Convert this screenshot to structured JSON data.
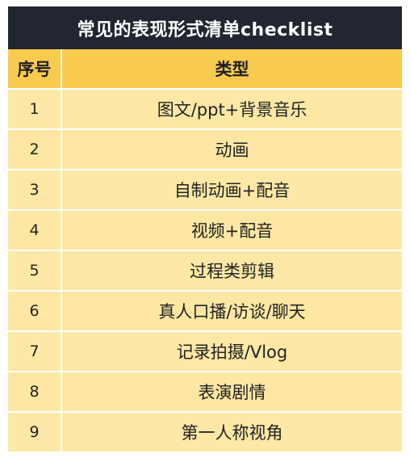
{
  "title": "常见的表现形式清单checklist",
  "header": {
    "index_label": "序号",
    "type_label": "类型"
  },
  "rows": [
    {
      "index": "1",
      "type": "图文/ppt+背景音乐"
    },
    {
      "index": "2",
      "type": "动画"
    },
    {
      "index": "3",
      "type": "自制动画+配音"
    },
    {
      "index": "4",
      "type": "视频+配音"
    },
    {
      "index": "5",
      "type": "过程类剪辑"
    },
    {
      "index": "6",
      "type": "真人口播/访谈/聊天"
    },
    {
      "index": "7",
      "type": "记录拍摄/Vlog"
    },
    {
      "index": "8",
      "type": "表演剧情"
    },
    {
      "index": "9",
      "type": "第一人称视角"
    }
  ],
  "colors": {
    "title_background": "#212631",
    "header_background": "#f8cb4f",
    "row_background": "#fde8a6"
  }
}
